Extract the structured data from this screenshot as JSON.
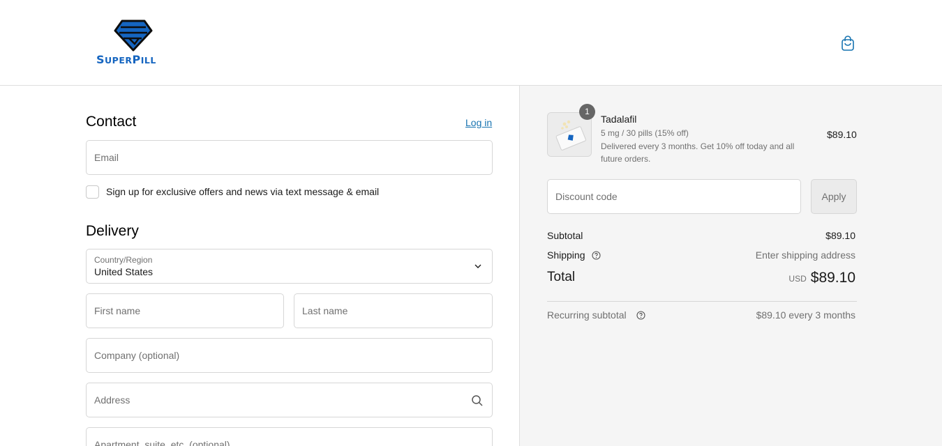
{
  "header": {
    "logo_text_lead": "S",
    "logo_text_rest": "UPER",
    "logo_text_lead2": "P",
    "logo_text_rest2": "ILL",
    "logo_alt": "SuperPill",
    "cart_icon": "shopping-bag-icon"
  },
  "contact": {
    "title": "Contact",
    "login_link": "Log in",
    "email_placeholder": "Email",
    "signup_label": "Sign up for exclusive offers and news via text message & email",
    "signup_checked": false
  },
  "delivery": {
    "title": "Delivery",
    "country_label": "Country/Region",
    "country_value": "United States",
    "first_name_placeholder": "First name",
    "last_name_placeholder": "Last name",
    "company_placeholder": "Company (optional)",
    "address_placeholder": "Address",
    "apartment_placeholder": "Apartment, suite, etc. (optional)"
  },
  "summary": {
    "product": {
      "quantity": "1",
      "name": "Tadalafil",
      "variant": "5 mg / 30 pills (15% off)",
      "note": "Delivered every 3 months. Get 10% off today and all future orders.",
      "price": "$89.10"
    },
    "discount_placeholder": "Discount code",
    "apply_label": "Apply",
    "subtotal_label": "Subtotal",
    "subtotal_value": "$89.10",
    "shipping_label": "Shipping",
    "shipping_value": "Enter shipping address",
    "total_label": "Total",
    "total_currency": "USD",
    "total_value": "$89.10",
    "recurring_label": "Recurring subtotal",
    "recurring_value": "$89.10 every 3 months"
  },
  "colors": {
    "brand": "#1565c0",
    "link": "#1773b0",
    "summary_bg": "#f5f5f5"
  }
}
